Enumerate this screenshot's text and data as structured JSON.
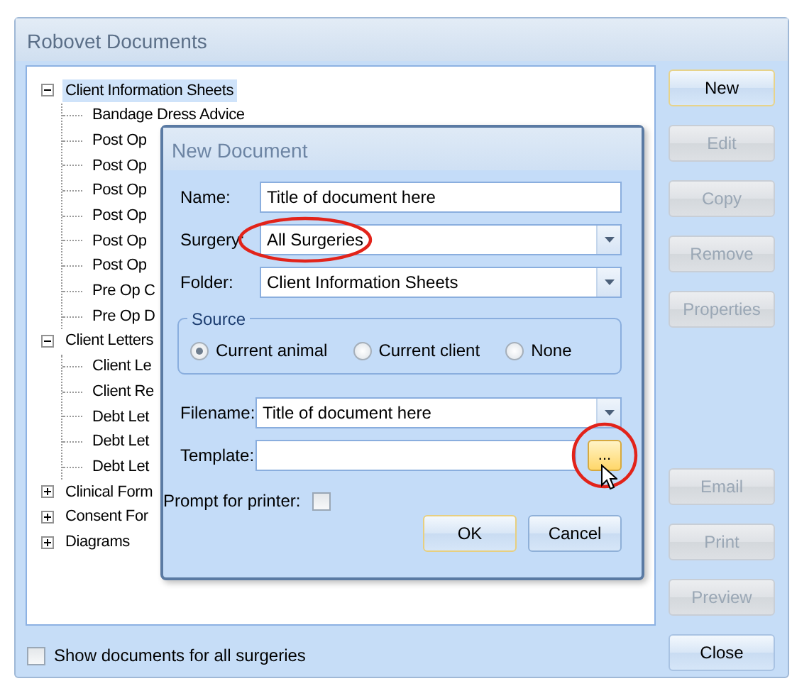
{
  "window": {
    "title": "Robovet Documents"
  },
  "tree": [
    {
      "label": "Client Information Sheets",
      "expanded": true,
      "selected": true,
      "children": [
        {
          "label": "Bandage Dress Advice",
          "selected": false
        },
        {
          "label": "Post Op",
          "selected": false
        },
        {
          "label": "Post Op",
          "selected": false
        },
        {
          "label": "Post Op",
          "selected": false
        },
        {
          "label": "Post Op",
          "selected": false
        },
        {
          "label": "Post Op",
          "selected": false
        },
        {
          "label": "Post Op",
          "selected": false
        },
        {
          "label": "Pre Op C",
          "selected": false
        },
        {
          "label": "Pre Op D",
          "selected": false
        }
      ]
    },
    {
      "label": "Client Letters",
      "expanded": true,
      "selected": false,
      "children": [
        {
          "label": "Client Le",
          "selected": false
        },
        {
          "label": "Client Re",
          "selected": false
        },
        {
          "label": "Debt Let",
          "selected": false
        },
        {
          "label": "Debt Let",
          "selected": false
        },
        {
          "label": "Debt Let",
          "selected": false
        }
      ]
    },
    {
      "label": "Clinical Form",
      "expanded": false,
      "selected": false
    },
    {
      "label": "Consent For",
      "expanded": false,
      "selected": false
    },
    {
      "label": "Diagrams",
      "expanded": false,
      "selected": false
    }
  ],
  "side_buttons": {
    "top": [
      {
        "label": "New",
        "disabled": false
      },
      {
        "label": "Edit",
        "disabled": true
      },
      {
        "label": "Copy",
        "disabled": true
      },
      {
        "label": "Remove",
        "disabled": true
      },
      {
        "label": "Properties",
        "disabled": true
      }
    ],
    "bottom": [
      {
        "label": "Email",
        "disabled": true
      },
      {
        "label": "Print",
        "disabled": true
      },
      {
        "label": "Preview",
        "disabled": true
      },
      {
        "label": "Close",
        "disabled": false
      }
    ]
  },
  "show_all_surgeries": {
    "label": "Show documents for all surgeries",
    "checked": false
  },
  "dialog": {
    "title": "New Document",
    "name": {
      "label": "Name:",
      "value": "Title of document here"
    },
    "surgery": {
      "label": "Surgery:",
      "value": "All Surgeries",
      "highlighted": true
    },
    "folder": {
      "label": "Folder:",
      "value": "Client Information Sheets"
    },
    "source": {
      "legend": "Source",
      "options": [
        {
          "label": "Current animal",
          "selected": true
        },
        {
          "label": "Current client",
          "selected": false
        },
        {
          "label": "None",
          "selected": false
        }
      ]
    },
    "filename": {
      "label": "Filename:",
      "value": "Title of document here"
    },
    "template": {
      "label": "Template:",
      "browse_label": "...",
      "highlighted": true
    },
    "prompt_for_printer": {
      "label": "Prompt for printer:",
      "checked": false
    },
    "buttons": [
      {
        "label": "OK",
        "default": true
      },
      {
        "label": "Cancel",
        "default": false
      }
    ]
  }
}
